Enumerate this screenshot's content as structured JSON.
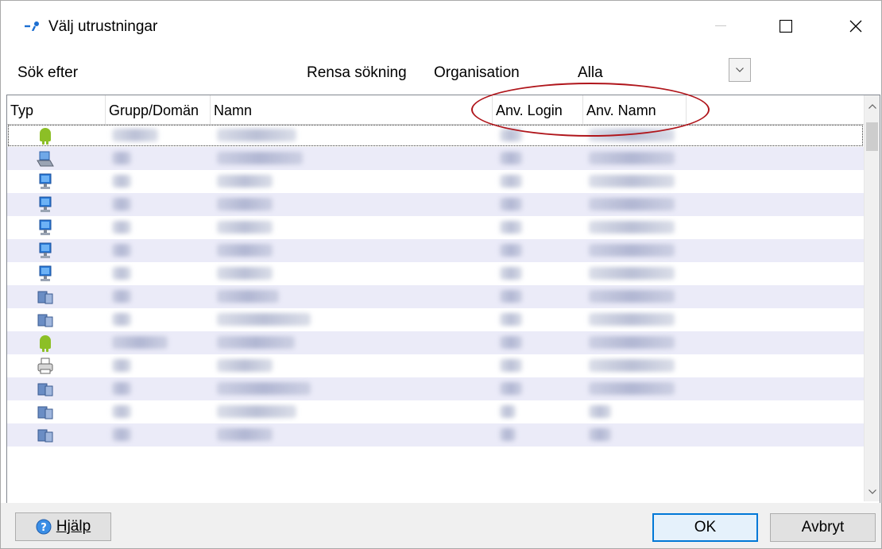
{
  "window": {
    "title": "Välj utrustningar"
  },
  "search": {
    "label": "Sök efter",
    "clear_label": "Rensa sökning",
    "organisation_label": "Organisation",
    "organisation_value": "Alla"
  },
  "grid": {
    "columns": [
      "Typ",
      "Grupp/Domän",
      "Namn",
      "Anv. Login",
      "Anv. Namn"
    ],
    "rows": [
      {
        "type": "android-icon"
      },
      {
        "type": "laptop-icon"
      },
      {
        "type": "desktop-icon"
      },
      {
        "type": "desktop-icon"
      },
      {
        "type": "desktop-icon"
      },
      {
        "type": "desktop-icon"
      },
      {
        "type": "desktop-icon"
      },
      {
        "type": "server-icon"
      },
      {
        "type": "server-icon"
      },
      {
        "type": "android-icon"
      },
      {
        "type": "printer-icon"
      },
      {
        "type": "server-icon"
      },
      {
        "type": "server-icon"
      },
      {
        "type": "server-icon"
      }
    ]
  },
  "footer": {
    "help_label": "Hjälp",
    "ok_label": "OK",
    "cancel_label": "Avbryt"
  },
  "colors": {
    "accent": "#0078d7",
    "row_alt": "#ebebf8",
    "annotation": "#b0161c",
    "android": "#8cbf26",
    "monitor": "#2b7bd8"
  }
}
